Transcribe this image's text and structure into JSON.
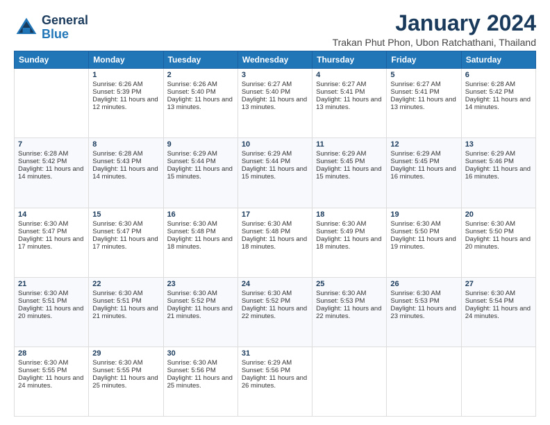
{
  "header": {
    "logo": {
      "general": "General",
      "blue": "Blue"
    },
    "month_year": "January 2024",
    "location": "Trakan Phut Phon, Ubon Ratchathani, Thailand"
  },
  "weekdays": [
    "Sunday",
    "Monday",
    "Tuesday",
    "Wednesday",
    "Thursday",
    "Friday",
    "Saturday"
  ],
  "weeks": [
    [
      {
        "day": "",
        "sunrise": "",
        "sunset": "",
        "daylight": ""
      },
      {
        "day": "1",
        "sunrise": "Sunrise: 6:26 AM",
        "sunset": "Sunset: 5:39 PM",
        "daylight": "Daylight: 11 hours and 12 minutes."
      },
      {
        "day": "2",
        "sunrise": "Sunrise: 6:26 AM",
        "sunset": "Sunset: 5:40 PM",
        "daylight": "Daylight: 11 hours and 13 minutes."
      },
      {
        "day": "3",
        "sunrise": "Sunrise: 6:27 AM",
        "sunset": "Sunset: 5:40 PM",
        "daylight": "Daylight: 11 hours and 13 minutes."
      },
      {
        "day": "4",
        "sunrise": "Sunrise: 6:27 AM",
        "sunset": "Sunset: 5:41 PM",
        "daylight": "Daylight: 11 hours and 13 minutes."
      },
      {
        "day": "5",
        "sunrise": "Sunrise: 6:27 AM",
        "sunset": "Sunset: 5:41 PM",
        "daylight": "Daylight: 11 hours and 13 minutes."
      },
      {
        "day": "6",
        "sunrise": "Sunrise: 6:28 AM",
        "sunset": "Sunset: 5:42 PM",
        "daylight": "Daylight: 11 hours and 14 minutes."
      }
    ],
    [
      {
        "day": "7",
        "sunrise": "Sunrise: 6:28 AM",
        "sunset": "Sunset: 5:42 PM",
        "daylight": "Daylight: 11 hours and 14 minutes."
      },
      {
        "day": "8",
        "sunrise": "Sunrise: 6:28 AM",
        "sunset": "Sunset: 5:43 PM",
        "daylight": "Daylight: 11 hours and 14 minutes."
      },
      {
        "day": "9",
        "sunrise": "Sunrise: 6:29 AM",
        "sunset": "Sunset: 5:44 PM",
        "daylight": "Daylight: 11 hours and 15 minutes."
      },
      {
        "day": "10",
        "sunrise": "Sunrise: 6:29 AM",
        "sunset": "Sunset: 5:44 PM",
        "daylight": "Daylight: 11 hours and 15 minutes."
      },
      {
        "day": "11",
        "sunrise": "Sunrise: 6:29 AM",
        "sunset": "Sunset: 5:45 PM",
        "daylight": "Daylight: 11 hours and 15 minutes."
      },
      {
        "day": "12",
        "sunrise": "Sunrise: 6:29 AM",
        "sunset": "Sunset: 5:45 PM",
        "daylight": "Daylight: 11 hours and 16 minutes."
      },
      {
        "day": "13",
        "sunrise": "Sunrise: 6:29 AM",
        "sunset": "Sunset: 5:46 PM",
        "daylight": "Daylight: 11 hours and 16 minutes."
      }
    ],
    [
      {
        "day": "14",
        "sunrise": "Sunrise: 6:30 AM",
        "sunset": "Sunset: 5:47 PM",
        "daylight": "Daylight: 11 hours and 17 minutes."
      },
      {
        "day": "15",
        "sunrise": "Sunrise: 6:30 AM",
        "sunset": "Sunset: 5:47 PM",
        "daylight": "Daylight: 11 hours and 17 minutes."
      },
      {
        "day": "16",
        "sunrise": "Sunrise: 6:30 AM",
        "sunset": "Sunset: 5:48 PM",
        "daylight": "Daylight: 11 hours and 18 minutes."
      },
      {
        "day": "17",
        "sunrise": "Sunrise: 6:30 AM",
        "sunset": "Sunset: 5:48 PM",
        "daylight": "Daylight: 11 hours and 18 minutes."
      },
      {
        "day": "18",
        "sunrise": "Sunrise: 6:30 AM",
        "sunset": "Sunset: 5:49 PM",
        "daylight": "Daylight: 11 hours and 18 minutes."
      },
      {
        "day": "19",
        "sunrise": "Sunrise: 6:30 AM",
        "sunset": "Sunset: 5:50 PM",
        "daylight": "Daylight: 11 hours and 19 minutes."
      },
      {
        "day": "20",
        "sunrise": "Sunrise: 6:30 AM",
        "sunset": "Sunset: 5:50 PM",
        "daylight": "Daylight: 11 hours and 20 minutes."
      }
    ],
    [
      {
        "day": "21",
        "sunrise": "Sunrise: 6:30 AM",
        "sunset": "Sunset: 5:51 PM",
        "daylight": "Daylight: 11 hours and 20 minutes."
      },
      {
        "day": "22",
        "sunrise": "Sunrise: 6:30 AM",
        "sunset": "Sunset: 5:51 PM",
        "daylight": "Daylight: 11 hours and 21 minutes."
      },
      {
        "day": "23",
        "sunrise": "Sunrise: 6:30 AM",
        "sunset": "Sunset: 5:52 PM",
        "daylight": "Daylight: 11 hours and 21 minutes."
      },
      {
        "day": "24",
        "sunrise": "Sunrise: 6:30 AM",
        "sunset": "Sunset: 5:52 PM",
        "daylight": "Daylight: 11 hours and 22 minutes."
      },
      {
        "day": "25",
        "sunrise": "Sunrise: 6:30 AM",
        "sunset": "Sunset: 5:53 PM",
        "daylight": "Daylight: 11 hours and 22 minutes."
      },
      {
        "day": "26",
        "sunrise": "Sunrise: 6:30 AM",
        "sunset": "Sunset: 5:53 PM",
        "daylight": "Daylight: 11 hours and 23 minutes."
      },
      {
        "day": "27",
        "sunrise": "Sunrise: 6:30 AM",
        "sunset": "Sunset: 5:54 PM",
        "daylight": "Daylight: 11 hours and 24 minutes."
      }
    ],
    [
      {
        "day": "28",
        "sunrise": "Sunrise: 6:30 AM",
        "sunset": "Sunset: 5:55 PM",
        "daylight": "Daylight: 11 hours and 24 minutes."
      },
      {
        "day": "29",
        "sunrise": "Sunrise: 6:30 AM",
        "sunset": "Sunset: 5:55 PM",
        "daylight": "Daylight: 11 hours and 25 minutes."
      },
      {
        "day": "30",
        "sunrise": "Sunrise: 6:30 AM",
        "sunset": "Sunset: 5:56 PM",
        "daylight": "Daylight: 11 hours and 25 minutes."
      },
      {
        "day": "31",
        "sunrise": "Sunrise: 6:29 AM",
        "sunset": "Sunset: 5:56 PM",
        "daylight": "Daylight: 11 hours and 26 minutes."
      },
      {
        "day": "",
        "sunrise": "",
        "sunset": "",
        "daylight": ""
      },
      {
        "day": "",
        "sunrise": "",
        "sunset": "",
        "daylight": ""
      },
      {
        "day": "",
        "sunrise": "",
        "sunset": "",
        "daylight": ""
      }
    ]
  ]
}
